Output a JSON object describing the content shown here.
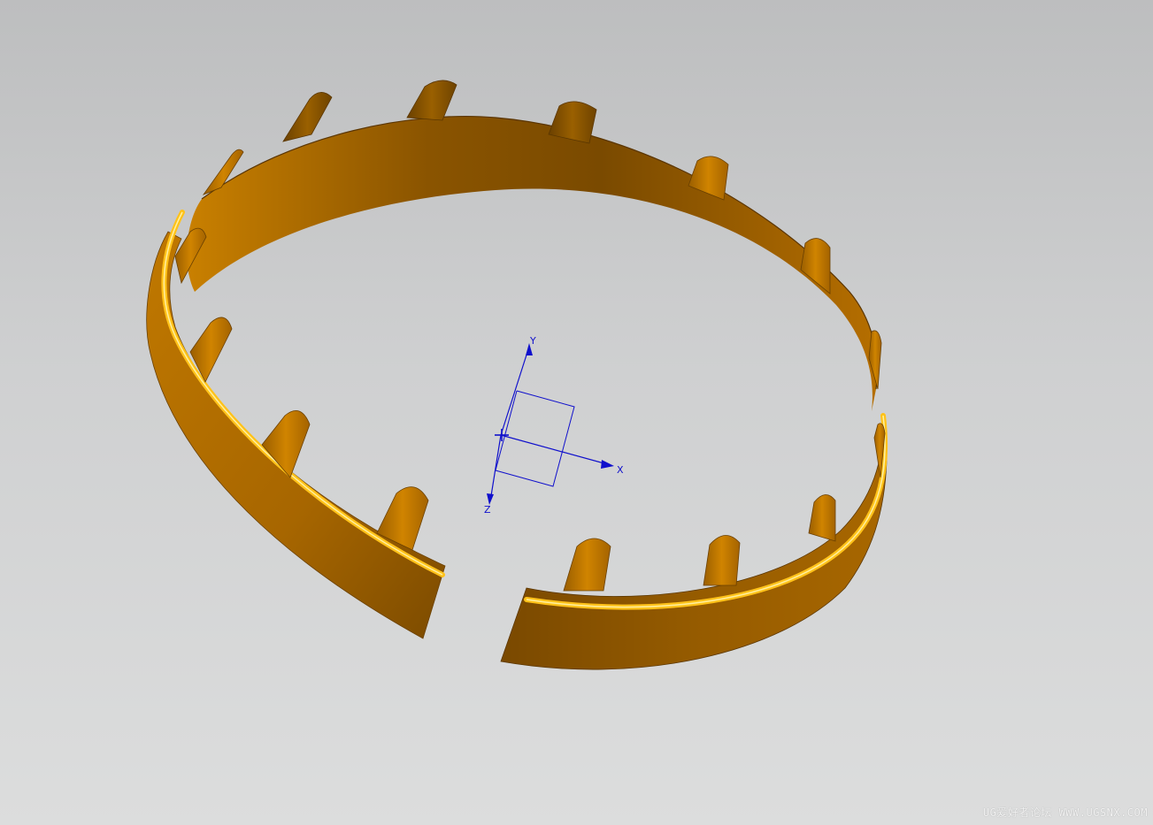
{
  "viewport": {
    "background_top": "#bdbebf",
    "background_bottom": "#dcdddd"
  },
  "model": {
    "name": "split-ring-with-tabs",
    "color_dark": "#7a4a00",
    "color_mid": "#b06c00",
    "color_light": "#e09a10",
    "color_highlight": "#ffc21a"
  },
  "triad": {
    "color": "#1010cc",
    "x_label": "X",
    "y_label": "Y",
    "z_label": "Z"
  },
  "watermark": {
    "text": "UG爱好者论坛 WWW.UGSNX.COM"
  }
}
